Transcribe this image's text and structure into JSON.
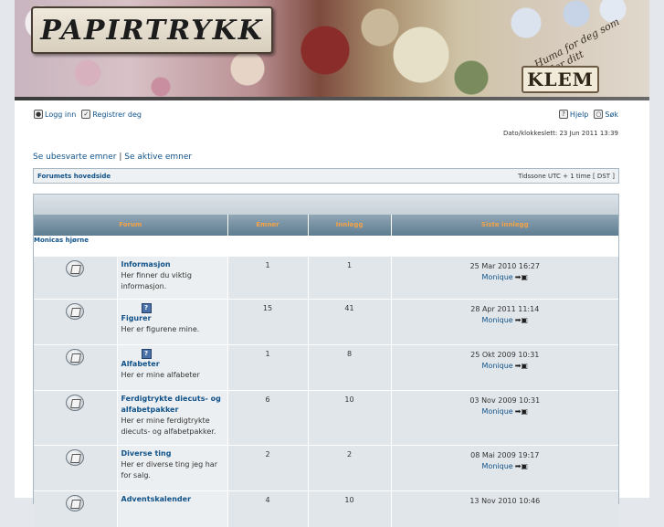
{
  "banner": {
    "logo_text": "PAPIRTRYKK",
    "badge_text": "KLEM",
    "script_text": "Huma for deg som tyller ditt"
  },
  "header": {
    "login_label": "Logg inn",
    "register_label": "Registrer deg",
    "help_label": "Hjelp",
    "search_label": "Søk",
    "datetime": "Dato/klokkeslett: 23 Jun 2011 13:39"
  },
  "quicklinks": {
    "unanswered": "Se ubesvarte emner",
    "separator": "|",
    "active": "Se aktive emner"
  },
  "nav": {
    "index": "Forumets hovedside",
    "timezone": "Tidssone UTC + 1 time [ DST ]"
  },
  "table": {
    "headers": {
      "forum": "Forum",
      "topics": "Emner",
      "posts": "Innlegg",
      "last": "Siste innlegg"
    },
    "category": "Monicas hjørne",
    "rows": [
      {
        "name": "Informasjon",
        "desc": "Her finner du viktig informasjon.",
        "topics": "1",
        "posts": "1",
        "last_date": "25 Mar 2010 16:27",
        "last_user": "Monique",
        "has_mini_icon": false
      },
      {
        "name": "Figurer",
        "desc": "Her er figurene mine.",
        "topics": "15",
        "posts": "41",
        "last_date": "28 Apr 2011 11:14",
        "last_user": "Monique",
        "has_mini_icon": true
      },
      {
        "name": "Alfabeter",
        "desc": "Her er mine alfabeter",
        "topics": "1",
        "posts": "8",
        "last_date": "25 Okt 2009 10:31",
        "last_user": "Monique",
        "has_mini_icon": true
      },
      {
        "name": "Ferdigtrykte diecuts- og alfabetpakker",
        "desc": "Her er mine ferdigtrykte diecuts- og alfabetpakker.",
        "topics": "6",
        "posts": "10",
        "last_date": "03 Nov 2009 10:31",
        "last_user": "Monique",
        "has_mini_icon": false
      },
      {
        "name": "Diverse ting",
        "desc": "Her er diverse ting jeg har for salg.",
        "topics": "2",
        "posts": "2",
        "last_date": "08 Mai 2009 19:17",
        "last_user": "Monique",
        "has_mini_icon": false
      },
      {
        "name": "Adventskalender",
        "desc": "",
        "topics": "4",
        "posts": "10",
        "last_date": "13 Nov 2010 10:46",
        "last_user": "",
        "has_mini_icon": false
      }
    ]
  }
}
